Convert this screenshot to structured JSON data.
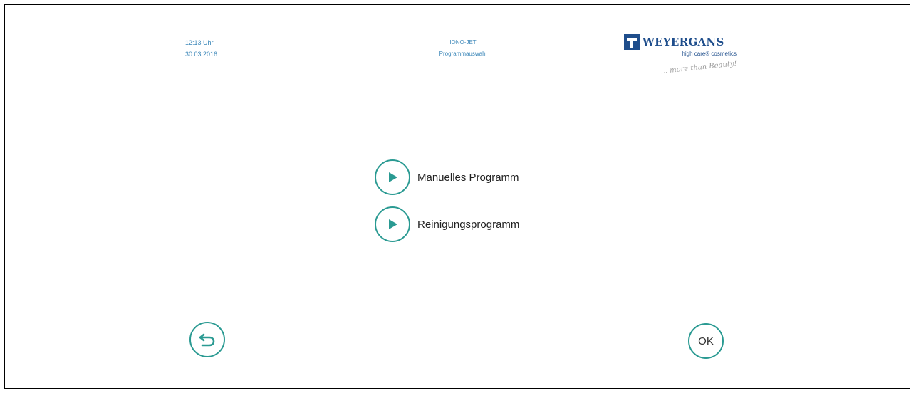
{
  "header": {
    "time": "12:13 Uhr",
    "date": "30.03.2016",
    "device_name": "IONO-JET",
    "screen_title": "Programmauswahl"
  },
  "logo": {
    "brand": "WEYERGANS",
    "subtitle": "high care® cosmetics",
    "tagline": "... more than Beauty!"
  },
  "menu": {
    "items": [
      {
        "label": "Manuelles Programm",
        "icon": "play-icon"
      },
      {
        "label": "Reinigungsprogramm",
        "icon": "play-icon"
      }
    ]
  },
  "footer": {
    "back_icon": "back-arrow-icon",
    "ok_label": "OK"
  },
  "colors": {
    "accent": "#2a9a92",
    "header_text": "#3a86b8",
    "brand": "#1f4e8c"
  }
}
